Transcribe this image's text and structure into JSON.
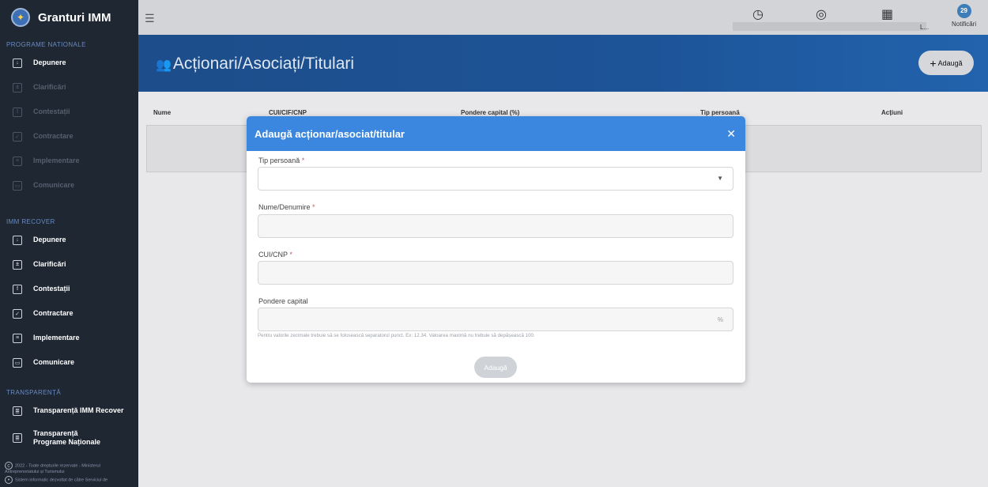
{
  "app": {
    "title": "Granturi IMM"
  },
  "sidebar": {
    "sections": [
      {
        "title": "PROGRAME NATIONALE",
        "items": [
          {
            "label": "Depunere",
            "icon": "inbox-icon",
            "enabled": true
          },
          {
            "label": "Clarificări",
            "icon": "clarify-icon",
            "enabled": false
          },
          {
            "label": "Contestații",
            "icon": "appeal-icon",
            "enabled": false
          },
          {
            "label": "Contractare",
            "icon": "check-box-icon",
            "enabled": false
          },
          {
            "label": "Implementare",
            "icon": "document-icon",
            "enabled": false
          },
          {
            "label": "Comunicare",
            "icon": "chat-icon",
            "enabled": false
          }
        ]
      },
      {
        "title": "IMM RECOVER",
        "items": [
          {
            "label": "Depunere",
            "icon": "inbox-icon",
            "enabled": true
          },
          {
            "label": "Clarificări",
            "icon": "clarify-icon",
            "enabled": true
          },
          {
            "label": "Contestații",
            "icon": "appeal-icon",
            "enabled": true
          },
          {
            "label": "Contractare",
            "icon": "check-box-icon",
            "enabled": true
          },
          {
            "label": "Implementare",
            "icon": "document-icon",
            "enabled": true
          },
          {
            "label": "Comunicare",
            "icon": "chat-icon",
            "enabled": true
          }
        ]
      },
      {
        "title": "TRANSPARENȚĂ",
        "items": [
          {
            "label": "Transparență IMM Recover",
            "icon": "list-icon",
            "enabled": true
          },
          {
            "label": "Transparență Programe Naționale",
            "icon": "list-icon",
            "enabled": true
          }
        ]
      }
    ],
    "footer": {
      "copyright": "2022 - Toate drepturile rezervate - Ministerul Antreprenoriatului și Turismului",
      "credit": "Sistem informatic dezvoltat de către Serviciul de"
    }
  },
  "topbar": {
    "menu_icon": "hamburger-icon",
    "icons": [
      "clock-icon",
      "user-circle-icon",
      "building-icon"
    ],
    "user_suffix": "L...",
    "notifications": {
      "count": "29",
      "label": "Notificări"
    }
  },
  "page": {
    "title": "Acționari/Asociați/Titulari",
    "add_label": "Adaugă"
  },
  "table": {
    "columns": [
      "Nume",
      "CUI/CIF/CNP",
      "Pondere capital (%)",
      "Tip persoană",
      "Acțiuni"
    ]
  },
  "modal": {
    "title": "Adaugă acționar/asociat/titular",
    "fields": {
      "tip_persoana": {
        "label": "Tip persoană",
        "required": "*",
        "value": ""
      },
      "nume": {
        "label": "Nume/Denumire",
        "required": "*",
        "value": ""
      },
      "cui": {
        "label": "CUI/CNP",
        "required": "*",
        "value": ""
      },
      "pondere": {
        "label": "Pondere capital",
        "value": "",
        "suffix": "%"
      }
    },
    "hint": "Pentru valorile zecimale trebuie să se folosească separatorul punct. Ex: 12.34. Valoarea maximă nu trebuie să depășească 100.",
    "submit_label": "Adaugă"
  },
  "colors": {
    "sidebar_bg": "#1f2733",
    "header_band": "#1d5498",
    "modal_header": "#3b87e0"
  }
}
